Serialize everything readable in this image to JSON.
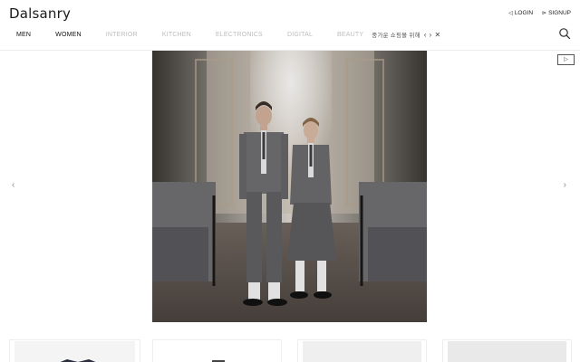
{
  "header": {
    "logo": "Dalsanry",
    "auth": [
      {
        "icon": "login-icon",
        "label": "LOGIN"
      },
      {
        "icon": "signup-icon",
        "label": "SIGNUP"
      }
    ]
  },
  "nav": {
    "items": [
      {
        "label": "MEN",
        "active": true
      },
      {
        "label": "WOMEN",
        "active": true
      },
      {
        "label": "INTERIOR",
        "active": false
      },
      {
        "label": "KITCHEN",
        "active": false
      },
      {
        "label": "ELECTRONICS",
        "active": false
      },
      {
        "label": "DIGITAL",
        "active": false
      },
      {
        "label": "BEAUTY",
        "active": false
      }
    ],
    "special": "중가운 쇼핑몰 위해",
    "prev_glyph": "‹",
    "next_glyph": "›",
    "close_glyph": "✕"
  },
  "hero": {
    "prev_glyph": "‹",
    "next_glyph": "›",
    "play_glyph": "▷"
  },
  "colors": {
    "accent": "#111111",
    "inactive": "#bdbdbd"
  }
}
